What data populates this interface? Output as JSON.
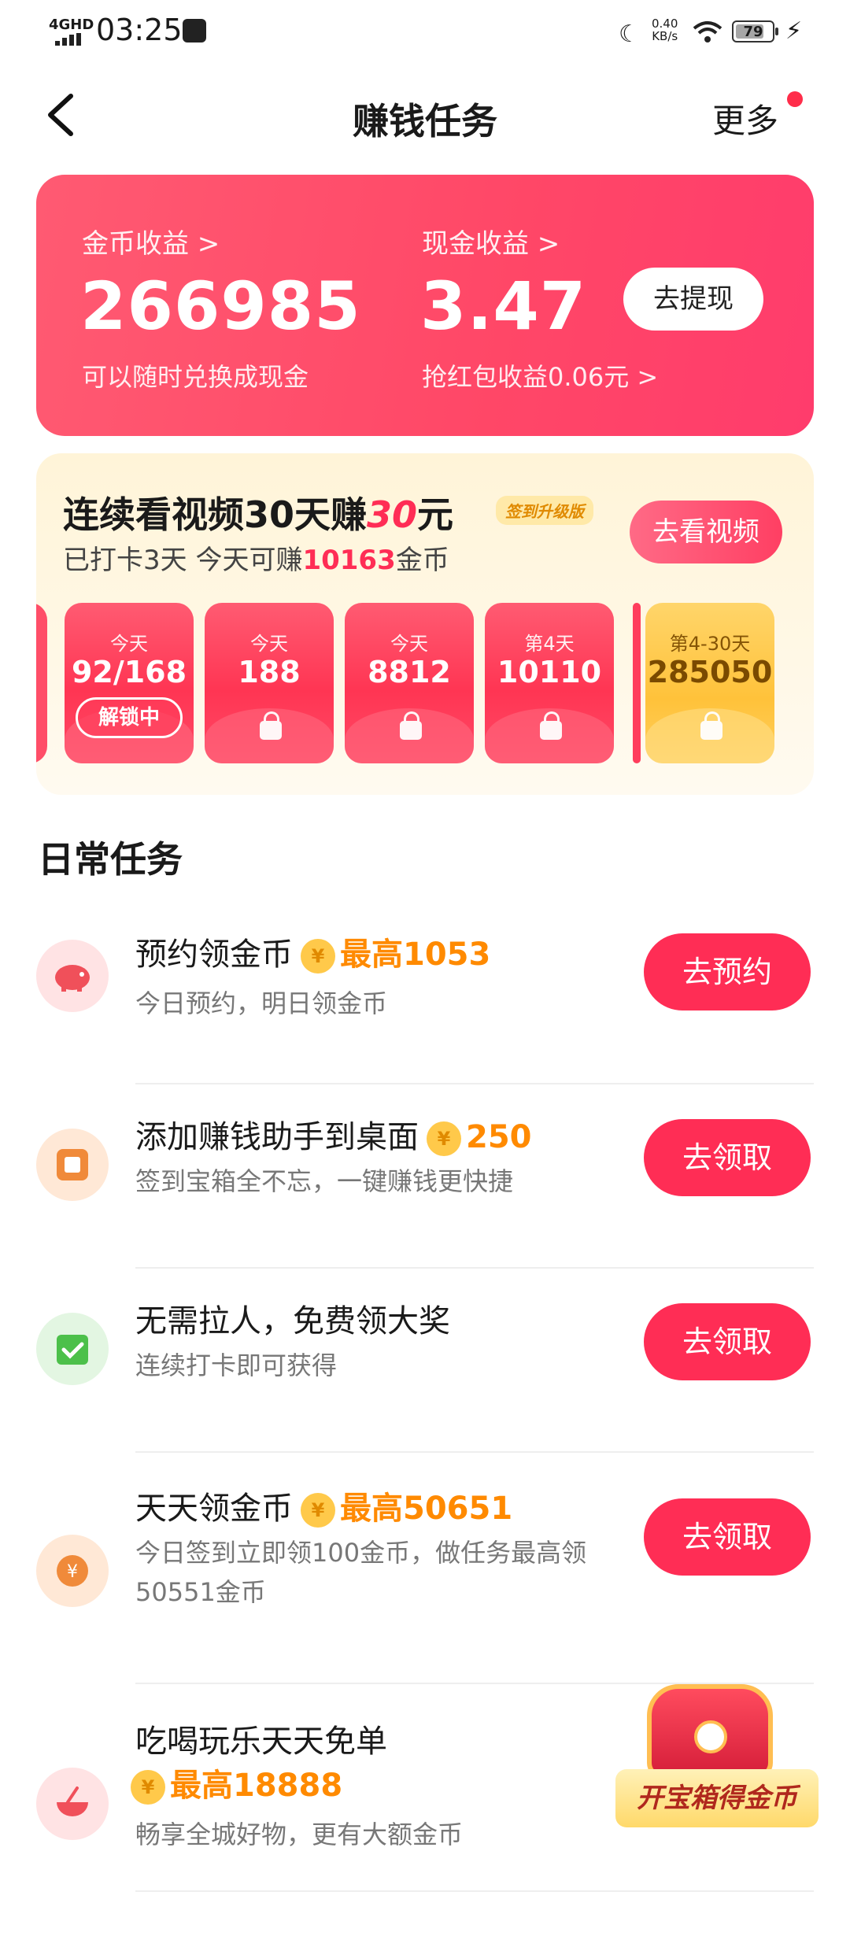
{
  "status_bar": {
    "network": "4GHD",
    "time": "03:25",
    "speed_value": "0.40",
    "speed_unit": "KB/s",
    "battery": "79",
    "battery_level": 0.79
  },
  "header": {
    "title": "赚钱任务",
    "more_label": "更多"
  },
  "earnings": {
    "coin_label": "金币收益 >",
    "coin_value": "266985",
    "coin_sub": "可以随时兑换成现金",
    "cash_label": "现金收益 >",
    "cash_value": "3.47",
    "cash_sub": "抢红包收益0.06元 >",
    "withdraw_label": "去提现"
  },
  "streak": {
    "headline_prefix": "连续看视频30天赚",
    "headline_amount": "30",
    "headline_suffix": "元",
    "tag": "签到升级版",
    "note_prefix": "已打卡3天 今天可赚",
    "note_amount": "10163",
    "note_suffix": "金币",
    "watch_label": "去看视频",
    "tiles": [
      {
        "top": "今天",
        "value": "92/168",
        "chip": "解锁中"
      },
      {
        "top": "今天",
        "value": "188"
      },
      {
        "top": "今天",
        "value": "8812"
      },
      {
        "top": "第4天",
        "value": "10110"
      },
      {
        "top": "第4-30天",
        "value": "285050"
      }
    ]
  },
  "daily": {
    "title": "日常任务",
    "tasks": [
      {
        "name": "预约领金币",
        "coin": "¥",
        "reward": "最高1053",
        "desc": "今日预约，明日领金币",
        "button": "去预约"
      },
      {
        "name": "添加赚钱助手到桌面",
        "coin": "¥",
        "reward": "250",
        "desc": "签到宝箱全不忘，一键赚钱更快捷",
        "button": "去领取"
      },
      {
        "name": "无需拉人，免费领大奖",
        "desc": "连续打卡即可获得",
        "button": "去领取"
      },
      {
        "name": "天天领金币",
        "coin": "¥",
        "reward": "最高50651",
        "desc": "今日签到立即领100金币，做任务最高领50551金币",
        "button": "去领取"
      },
      {
        "name": "吃喝玩乐天天免单",
        "coin": "¥",
        "reward": "最高18888",
        "desc": "畅享全城好物，更有大额金币"
      }
    ]
  },
  "chest": {
    "label": "开宝箱得金币"
  }
}
